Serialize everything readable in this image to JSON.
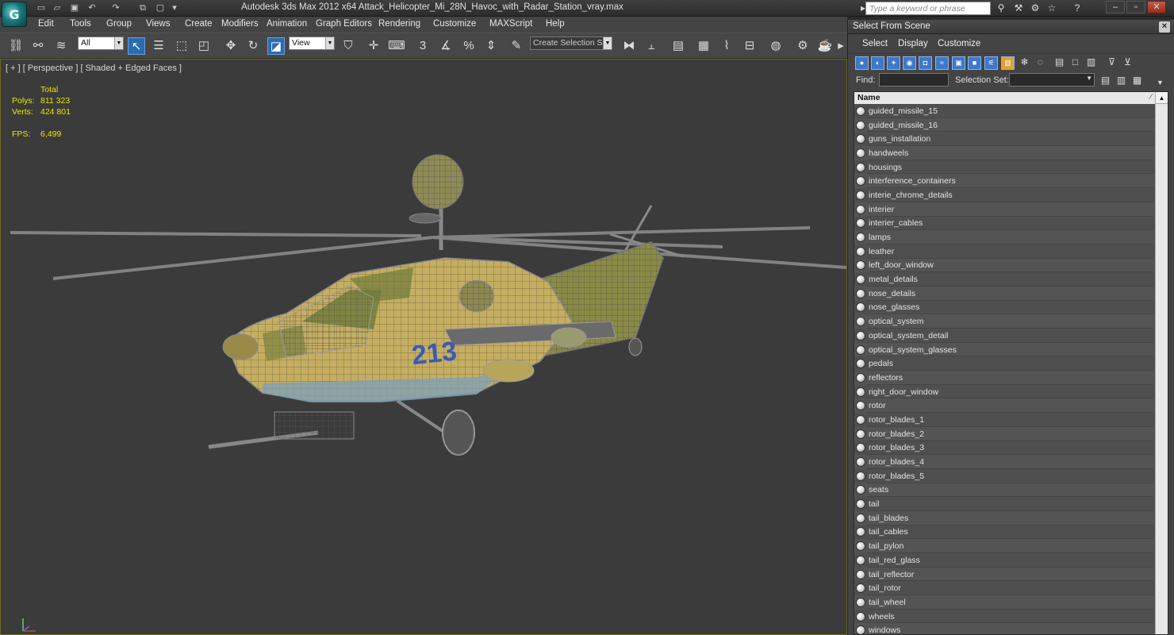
{
  "app": {
    "logo_text": "G",
    "title": "Autodesk 3ds Max  2012 x64       Attack_Helicopter_Mi_28N_Havoc_with_Radar_Station_vray.max",
    "search_placeholder": "Type a keyword or phrase"
  },
  "menu": [
    "Edit",
    "Tools",
    "Group",
    "Views",
    "Create",
    "Modifiers",
    "Animation",
    "Graph Editors",
    "Rendering",
    "Customize",
    "MAXScript",
    "Help"
  ],
  "toolbar": {
    "filter_value": "All",
    "ref_coord_value": "View",
    "selection_set_placeholder": "Create Selection Se"
  },
  "viewport": {
    "label": "[ + ] [ Perspective ] [ Shaded + Edged Faces ]",
    "stats_header": "Total",
    "polys_label": "Polys:",
    "polys_value": "811 323",
    "verts_label": "Verts:",
    "verts_value": "424 801",
    "fps_label": "FPS:",
    "fps_value": "6,499",
    "tail_number": "213"
  },
  "dialog": {
    "title": "Select From Scene",
    "menu": [
      "Select",
      "Display",
      "Customize"
    ],
    "find_label": "Find:",
    "selection_set_label": "Selection Set:",
    "column_header": "Name",
    "objects": [
      "guided_missile_15",
      "guided_missile_16",
      "guns_installation",
      "handweels",
      "housings",
      "interference_containers",
      "interie_chrome_details",
      "interier",
      "interier_cables",
      "lamps",
      "leather",
      "left_door_window",
      "metal_details",
      "nose_details",
      "nose_glasses",
      "optical_system",
      "optical_system_detail",
      "optical_system_glasses",
      "pedals",
      "reflectors",
      "right_door_window",
      "rotor",
      "rotor_blades_1",
      "rotor_blades_2",
      "rotor_blades_3",
      "rotor_blades_4",
      "rotor_blades_5",
      "seats",
      "tail",
      "tail_blades",
      "tail_cables",
      "tail_pylon",
      "tail_red_glass",
      "tail_reflector",
      "tail_rotor",
      "tail_wheel",
      "wheels",
      "windows"
    ]
  },
  "colors": {
    "stats_yellow": "#e8e800",
    "viewport_bg": "#3b3b3b",
    "active_blue": "#2b6cb0",
    "wire_grey": "#9a9a9a",
    "body_tan": "#c8b060"
  }
}
